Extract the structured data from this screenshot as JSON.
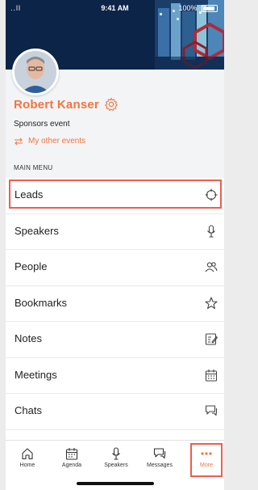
{
  "status_bar": {
    "signal": "..ll",
    "time": "9:41 AM",
    "battery": "100%"
  },
  "profile": {
    "name": "Robert Kanser",
    "event": "Sponsors event",
    "other_events_link": "My other events"
  },
  "menu": {
    "heading": "MAIN MENU",
    "items": [
      {
        "label": "Leads",
        "icon": "crosshair-icon"
      },
      {
        "label": "Speakers",
        "icon": "microphone-icon"
      },
      {
        "label": "People",
        "icon": "people-icon"
      },
      {
        "label": "Bookmarks",
        "icon": "star-icon"
      },
      {
        "label": "Notes",
        "icon": "notes-icon"
      },
      {
        "label": "Meetings",
        "icon": "calendar-icon"
      },
      {
        "label": "Chats",
        "icon": "chat-icon"
      }
    ]
  },
  "tabbar": {
    "tabs": [
      {
        "label": "Home",
        "icon": "home-icon"
      },
      {
        "label": "Agenda",
        "icon": "calendar-icon"
      },
      {
        "label": "Speakers",
        "icon": "microphone-icon"
      },
      {
        "label": "Messages",
        "icon": "messages-icon"
      },
      {
        "label": "More",
        "icon": "more-dots-icon",
        "active": true
      }
    ]
  },
  "colors": {
    "accent": "#f07542",
    "highlight": "#ef5d4d",
    "hero": "#0c2447"
  }
}
